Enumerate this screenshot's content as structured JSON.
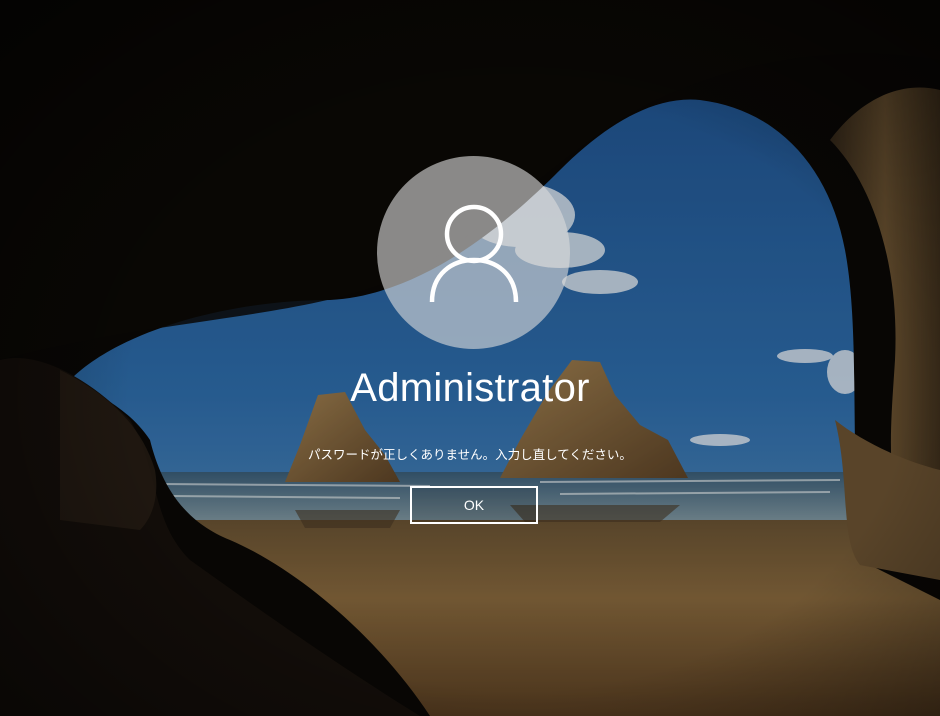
{
  "lock_screen": {
    "background": "cave-beach-wallpaper",
    "avatar_icon": "user-icon",
    "username": "Administrator",
    "error_message": "パスワードが正しくありません。入力し直してください。",
    "ok_label": "OK"
  },
  "colors": {
    "text": "#ffffff",
    "avatar_circle": "#d9d9d9",
    "button_border": "#ffffff"
  }
}
